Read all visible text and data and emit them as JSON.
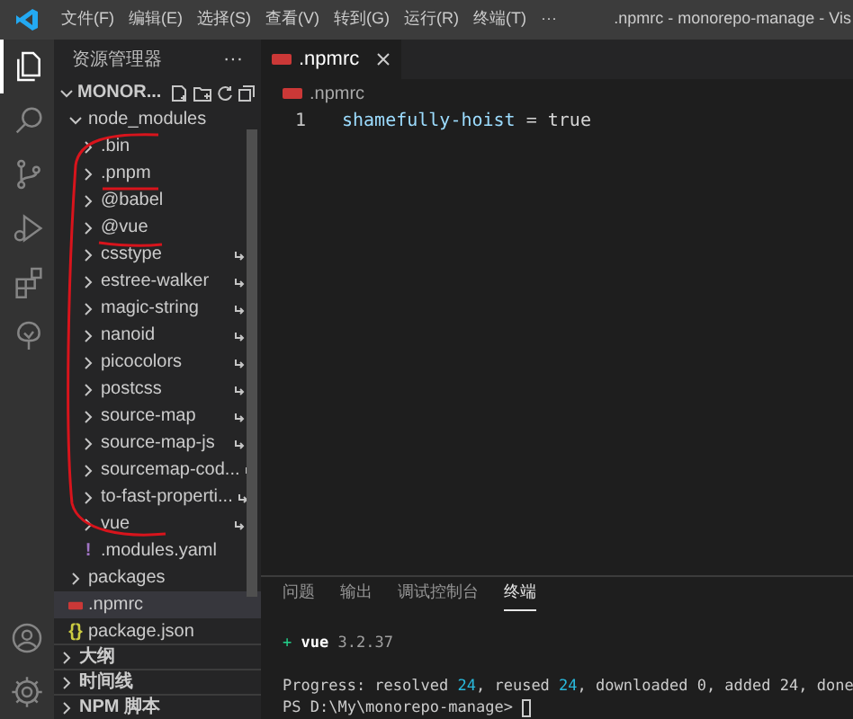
{
  "title_bar": {
    "menu": [
      "文件(F)",
      "编辑(E)",
      "选择(S)",
      "查看(V)",
      "转到(G)",
      "运行(R)",
      "终端(T)",
      "···"
    ],
    "title": ".npmrc - monorepo-manage - Vis"
  },
  "activity_bar": [
    {
      "kind": "explorer",
      "selected": true
    },
    {
      "kind": "search",
      "selected": false
    },
    {
      "kind": "source-control",
      "selected": false
    },
    {
      "kind": "run",
      "selected": false
    },
    {
      "kind": "extensions",
      "selected": false
    },
    {
      "kind": "tree",
      "selected": false
    }
  ],
  "activity_bar_bottom": [
    {
      "kind": "account"
    },
    {
      "kind": "settings"
    }
  ],
  "sidebar": {
    "title": "资源管理器",
    "more": "···",
    "folder": "MONOR...",
    "tree": [
      {
        "name": "node_modules",
        "kind": "folder",
        "expanded": true,
        "selected": false,
        "children": [
          {
            "name": ".bin",
            "kind": "folder",
            "expanded": false,
            "symlink": false
          },
          {
            "name": ".pnpm",
            "kind": "folder",
            "expanded": false,
            "symlink": false
          },
          {
            "name": "@babel",
            "kind": "folder",
            "expanded": false,
            "symlink": false
          },
          {
            "name": "@vue",
            "kind": "folder",
            "expanded": false,
            "symlink": false
          },
          {
            "name": "csstype",
            "kind": "folder",
            "expanded": false,
            "symlink": true
          },
          {
            "name": "estree-walker",
            "kind": "folder",
            "expanded": false,
            "symlink": true
          },
          {
            "name": "magic-string",
            "kind": "folder",
            "expanded": false,
            "symlink": true
          },
          {
            "name": "nanoid",
            "kind": "folder",
            "expanded": false,
            "symlink": true
          },
          {
            "name": "picocolors",
            "kind": "folder",
            "expanded": false,
            "symlink": true
          },
          {
            "name": "postcss",
            "kind": "folder",
            "expanded": false,
            "symlink": true
          },
          {
            "name": "source-map",
            "kind": "folder",
            "expanded": false,
            "symlink": true
          },
          {
            "name": "source-map-js",
            "kind": "folder",
            "expanded": false,
            "symlink": true
          },
          {
            "name": "sourcemap-cod...",
            "kind": "folder",
            "expanded": false,
            "symlink": true
          },
          {
            "name": "to-fast-properti...",
            "kind": "folder",
            "expanded": false,
            "symlink": true
          },
          {
            "name": "vue",
            "kind": "folder",
            "expanded": false,
            "symlink": true
          },
          {
            "name": ".modules.yaml",
            "kind": "yaml",
            "glyph": "!",
            "symlink": false
          }
        ]
      },
      {
        "name": "packages",
        "kind": "folder",
        "expanded": false,
        "selected": false
      },
      {
        "name": ".npmrc",
        "kind": "npmrc",
        "selected": true
      },
      {
        "name": "package.json",
        "kind": "json",
        "glyph": "{}",
        "selected": false
      }
    ],
    "sections": [
      {
        "name": "大纲",
        "expanded": false
      },
      {
        "name": "时间线",
        "expanded": false
      },
      {
        "name": "NPM 脚本",
        "expanded": false
      }
    ]
  },
  "editor": {
    "tabs": [
      {
        "name": ".npmrc",
        "selected": true
      }
    ],
    "breadcrumb": ".npmrc",
    "lines": [
      {
        "number": "1",
        "key": "shamefully-hoist",
        "rest": " = true"
      }
    ]
  },
  "panel": {
    "tabs": [
      {
        "label": "问题",
        "selected": false
      },
      {
        "label": "输出",
        "selected": false
      },
      {
        "label": "调试控制台",
        "selected": false
      },
      {
        "label": "终端",
        "selected": true
      }
    ],
    "terminal": [
      [
        {
          "text": "+ ",
          "kind": "added"
        },
        {
          "text": "vue",
          "kind": "bold"
        },
        {
          "text": " 3.2.37",
          "kind": "dim"
        }
      ],
      [
        {
          "text": "Progress: resolved ",
          "kind": "plain"
        },
        {
          "text": "24",
          "kind": "number"
        },
        {
          "text": ", reused ",
          "kind": "plain"
        },
        {
          "text": "24",
          "kind": "number"
        },
        {
          "text": ", downloaded 0, added 24, done",
          "kind": "plain"
        }
      ],
      [
        {
          "text": "PS D:\\My\\monorepo-manage> ",
          "kind": "plain"
        }
      ]
    ]
  }
}
